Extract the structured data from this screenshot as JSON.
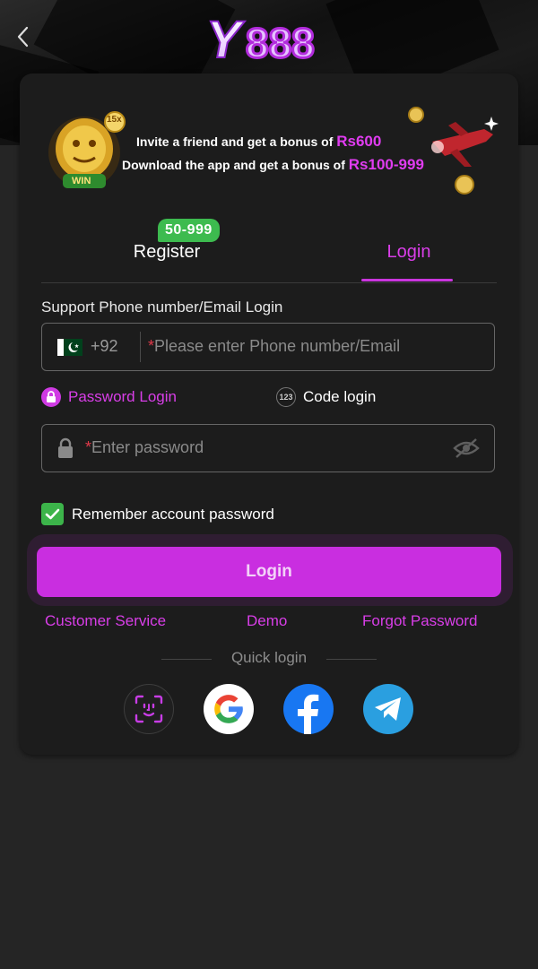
{
  "header": {
    "logo_text": "Y888"
  },
  "banner": {
    "line1_prefix": "Invite a friend and get a bonus of ",
    "line1_amount": "Rs600",
    "line2_prefix": "Download the app and get a bonus of ",
    "line2_amount": "Rs100-999",
    "badge_left": "15x",
    "slot_label": "WIN"
  },
  "tabs": {
    "register_label": "Register",
    "register_badge": "50-999",
    "login_label": "Login",
    "active": "Login"
  },
  "form": {
    "support_label": "Support Phone number/Email Login",
    "country_code": "+92",
    "phone_placeholder": "Please enter Phone number/Email",
    "password_placeholder": "Enter password",
    "required_mark": "*",
    "password_login_label": "Password Login",
    "code_login_label": "Code login",
    "code_icon_text": "123",
    "remember_label": "Remember account password",
    "remember_checked": true,
    "login_button": "Login"
  },
  "links": {
    "customer_service": "Customer Service",
    "demo": "Demo",
    "forgot_password": "Forgot Password"
  },
  "quick_login": {
    "label": "Quick login",
    "providers": [
      "face-id-icon",
      "google-icon",
      "facebook-icon",
      "telegram-icon"
    ]
  },
  "colors": {
    "accent": "#c92ee0",
    "accent_text": "#d93ee8",
    "badge_green": "#3dbb4f",
    "background": "#252525",
    "card": "#1c1c1c"
  }
}
